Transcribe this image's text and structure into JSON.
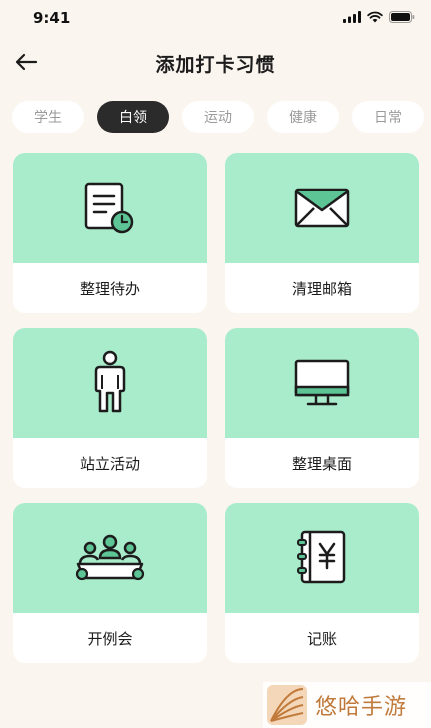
{
  "status_bar": {
    "time": "9:41"
  },
  "nav": {
    "title": "添加打卡习惯",
    "back_icon": "arrow-left-icon"
  },
  "tabs": [
    {
      "label": "学生",
      "active": false
    },
    {
      "label": "白领",
      "active": true
    },
    {
      "label": "运动",
      "active": false
    },
    {
      "label": "健康",
      "active": false
    },
    {
      "label": "日常",
      "active": false
    }
  ],
  "habits": [
    {
      "label": "整理待办",
      "icon": "document-clock-icon"
    },
    {
      "label": "清理邮箱",
      "icon": "envelope-icon"
    },
    {
      "label": "站立活动",
      "icon": "standing-person-icon"
    },
    {
      "label": "整理桌面",
      "icon": "monitor-icon"
    },
    {
      "label": "开例会",
      "icon": "meeting-icon"
    },
    {
      "label": "记账",
      "icon": "ledger-yen-icon"
    }
  ],
  "colors": {
    "card_top": "#a9eccc",
    "active_tab": "#2b2b2b",
    "background": "#fbf5ef"
  },
  "watermark": {
    "text": "悠哈手游"
  }
}
